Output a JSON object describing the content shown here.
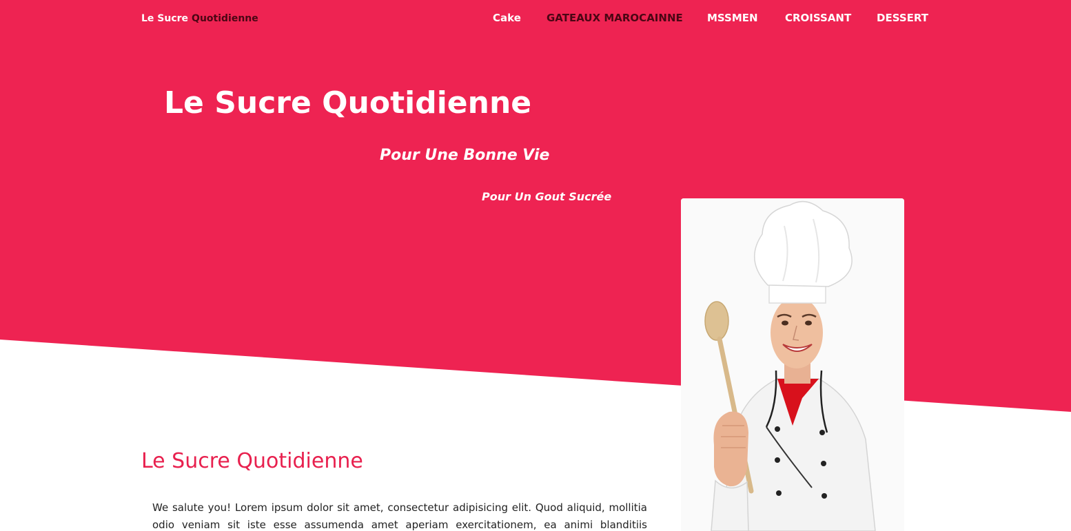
{
  "colors": {
    "brand_pink": "#ee2352",
    "dark_accent": "#4a0614",
    "section_title": "#e8204e",
    "white": "#ffffff"
  },
  "navbar": {
    "brand_part1": "Le Sucre",
    "brand_part2": "Quotidienne",
    "links": [
      {
        "label": "Cake",
        "active": false
      },
      {
        "label": "GATEAUX MAROCAINNE",
        "active": true
      },
      {
        "label": "MSSMEN",
        "active": false
      },
      {
        "label": "CROISSANT",
        "active": false
      },
      {
        "label": "DESSERT",
        "active": false
      }
    ]
  },
  "hero": {
    "title": "Le Sucre Quotidienne",
    "subtitle": "Pour Une Bonne Vie",
    "tagline": "Pour Un Gout Sucrée",
    "image_icon": "chef-with-wooden-spoon"
  },
  "section": {
    "title": "Le Sucre Quotidienne",
    "text": "We salute you! Lorem ipsum dolor sit amet, consectetur adipisicing elit. Quod aliquid, mollitia odio veniam sit iste esse assumenda amet aperiam exercitationem, ea animi blanditiis recusandae!"
  }
}
